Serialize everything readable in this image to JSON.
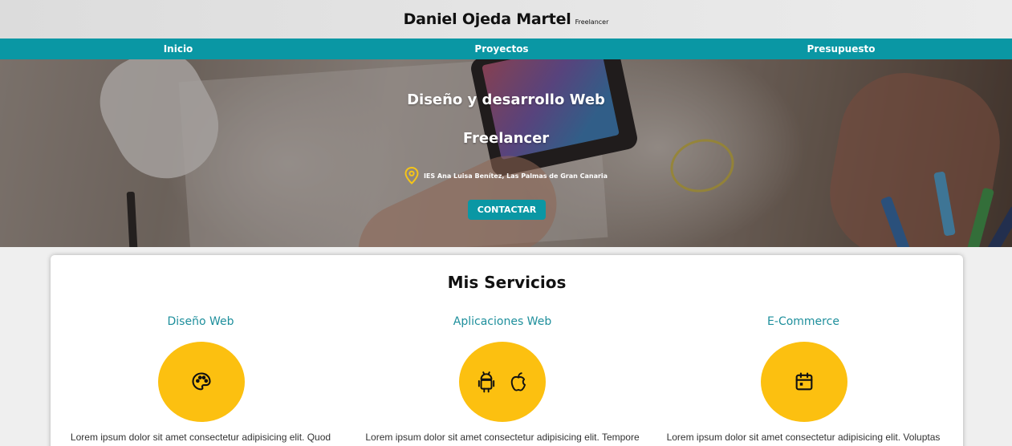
{
  "header": {
    "name": "Daniel Ojeda Martel",
    "tagline": "Freelancer"
  },
  "nav": {
    "items": [
      {
        "label": "Inicio"
      },
      {
        "label": "Proyectos"
      },
      {
        "label": "Presupuesto"
      }
    ]
  },
  "hero": {
    "title_line1": "Diseño y desarrollo Web",
    "title_line2": "Freelancer",
    "location_icon": "map-pin-icon",
    "location": "IES Ana Luisa Benítez, Las Palmas de Gran Canaria",
    "contact_label": "CONTACTAR"
  },
  "services": {
    "title": "Mis Servicios",
    "accent_color": "#fcc010",
    "items": [
      {
        "name": "Diseño Web",
        "icons": [
          "palette-icon"
        ],
        "text": "Lorem ipsum dolor sit amet consectetur adipisicing elit. Quod"
      },
      {
        "name": "Aplicaciones Web",
        "icons": [
          "android-icon",
          "apple-icon"
        ],
        "text": "Lorem ipsum dolor sit amet consectetur adipisicing elit. Tempore"
      },
      {
        "name": "E-Commerce",
        "icons": [
          "calendar-icon"
        ],
        "text": "Lorem ipsum dolor sit amet consectetur adipisicing elit. Voluptas"
      }
    ]
  },
  "colors": {
    "nav_bg": "#0a97a4",
    "button_bg": "#0a97a4",
    "service_title": "#1e8f9c",
    "icon_circle": "#fcc010"
  }
}
